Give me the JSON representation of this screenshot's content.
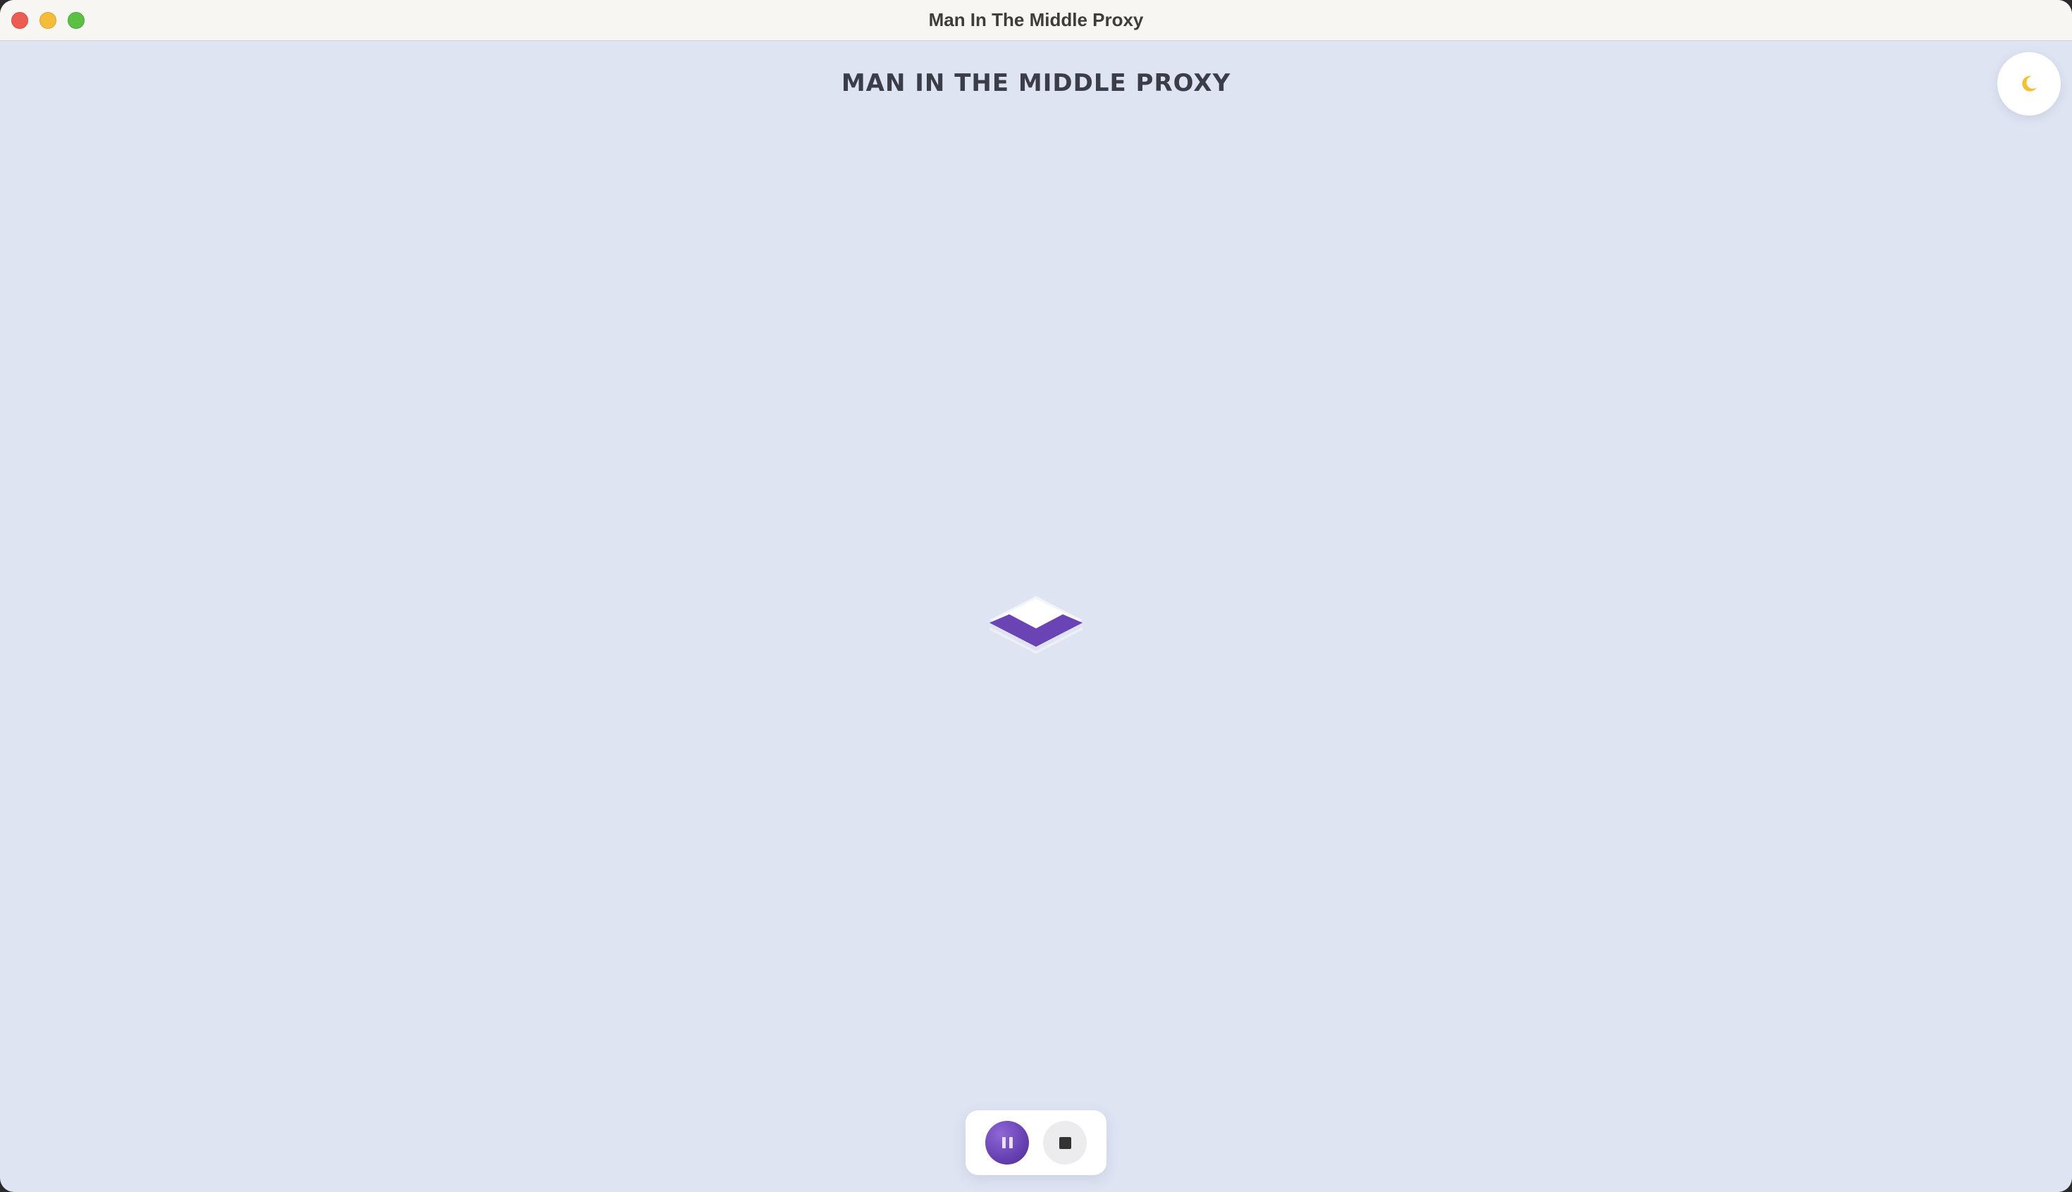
{
  "window": {
    "title": "Man In The Middle Proxy",
    "traffic_lights": [
      "close",
      "minimize",
      "maximize"
    ]
  },
  "header": {
    "heading": "MAN IN THE MIDDLE PROXY"
  },
  "theme_toggle": {
    "icon": "moon-icon",
    "icon_color": "#f2c232"
  },
  "loader": {
    "icon": "layers-icon",
    "accent_color": "#6a43b5"
  },
  "controls": {
    "pause_icon": "pause-icon",
    "stop_icon": "stop-icon",
    "accent_color": "#6a43b5"
  },
  "colors": {
    "background": "#dfe4f3",
    "titlebar": "#f8f6f2",
    "heading_text": "#3b3d48"
  }
}
